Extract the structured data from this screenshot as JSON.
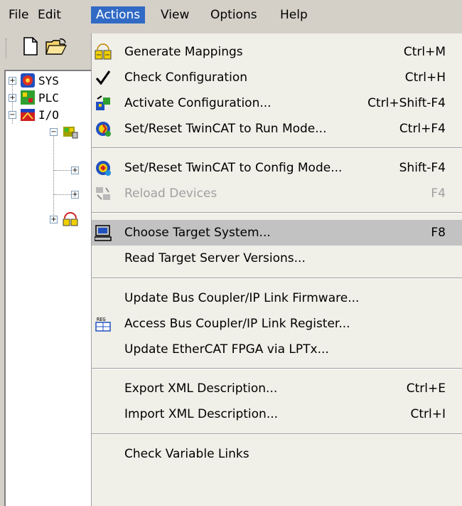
{
  "menubar": {
    "items": [
      {
        "label": "File"
      },
      {
        "label": "Edit"
      },
      {
        "label": "Actions"
      },
      {
        "label": "View"
      },
      {
        "label": "Options"
      },
      {
        "label": "Help"
      }
    ]
  },
  "tree": {
    "items": [
      {
        "label": "SYS"
      },
      {
        "label": "PLC"
      },
      {
        "label": "I/O"
      }
    ]
  },
  "actions_menu": {
    "items": [
      {
        "label": "Generate Mappings",
        "shortcut": "Ctrl+M",
        "icon": "generate-mappings-icon"
      },
      {
        "label": "Check Configuration",
        "shortcut": "Ctrl+H",
        "icon": "checkmark-icon"
      },
      {
        "label": "Activate Configuration...",
        "shortcut": "Ctrl+Shift-F4",
        "icon": "activate-configuration-icon"
      },
      {
        "label": "Set/Reset TwinCAT to Run Mode...",
        "shortcut": "Ctrl+F4",
        "icon": "run-mode-icon"
      },
      {
        "label": "Set/Reset TwinCAT to Config Mode...",
        "shortcut": "Shift-F4",
        "icon": "config-mode-icon"
      },
      {
        "label": "Reload Devices",
        "shortcut": "F4",
        "icon": "reload-devices-icon",
        "disabled": true
      },
      {
        "label": "Choose Target System...",
        "shortcut": "F8",
        "icon": "computer-icon",
        "highlighted": true
      },
      {
        "label": "Read Target Server Versions...",
        "shortcut": ""
      },
      {
        "label": "Update Bus Coupler/IP Link Firmware...",
        "shortcut": ""
      },
      {
        "label": "Access Bus Coupler/IP Link Register...",
        "shortcut": "",
        "icon": "register-icon"
      },
      {
        "label": "Update EtherCAT FPGA via LPTx...",
        "shortcut": ""
      },
      {
        "label": "Export XML Description...",
        "shortcut": "Ctrl+E"
      },
      {
        "label": "Import XML Description...",
        "shortcut": "Ctrl+I"
      },
      {
        "label": "Check Variable Links",
        "shortcut": ""
      }
    ]
  },
  "colors": {
    "menu_highlight": "#316ac5",
    "item_hover": "#c2c2c2",
    "menu_bg": "#f0efe8",
    "disabled_text": "#a0a0a0"
  }
}
